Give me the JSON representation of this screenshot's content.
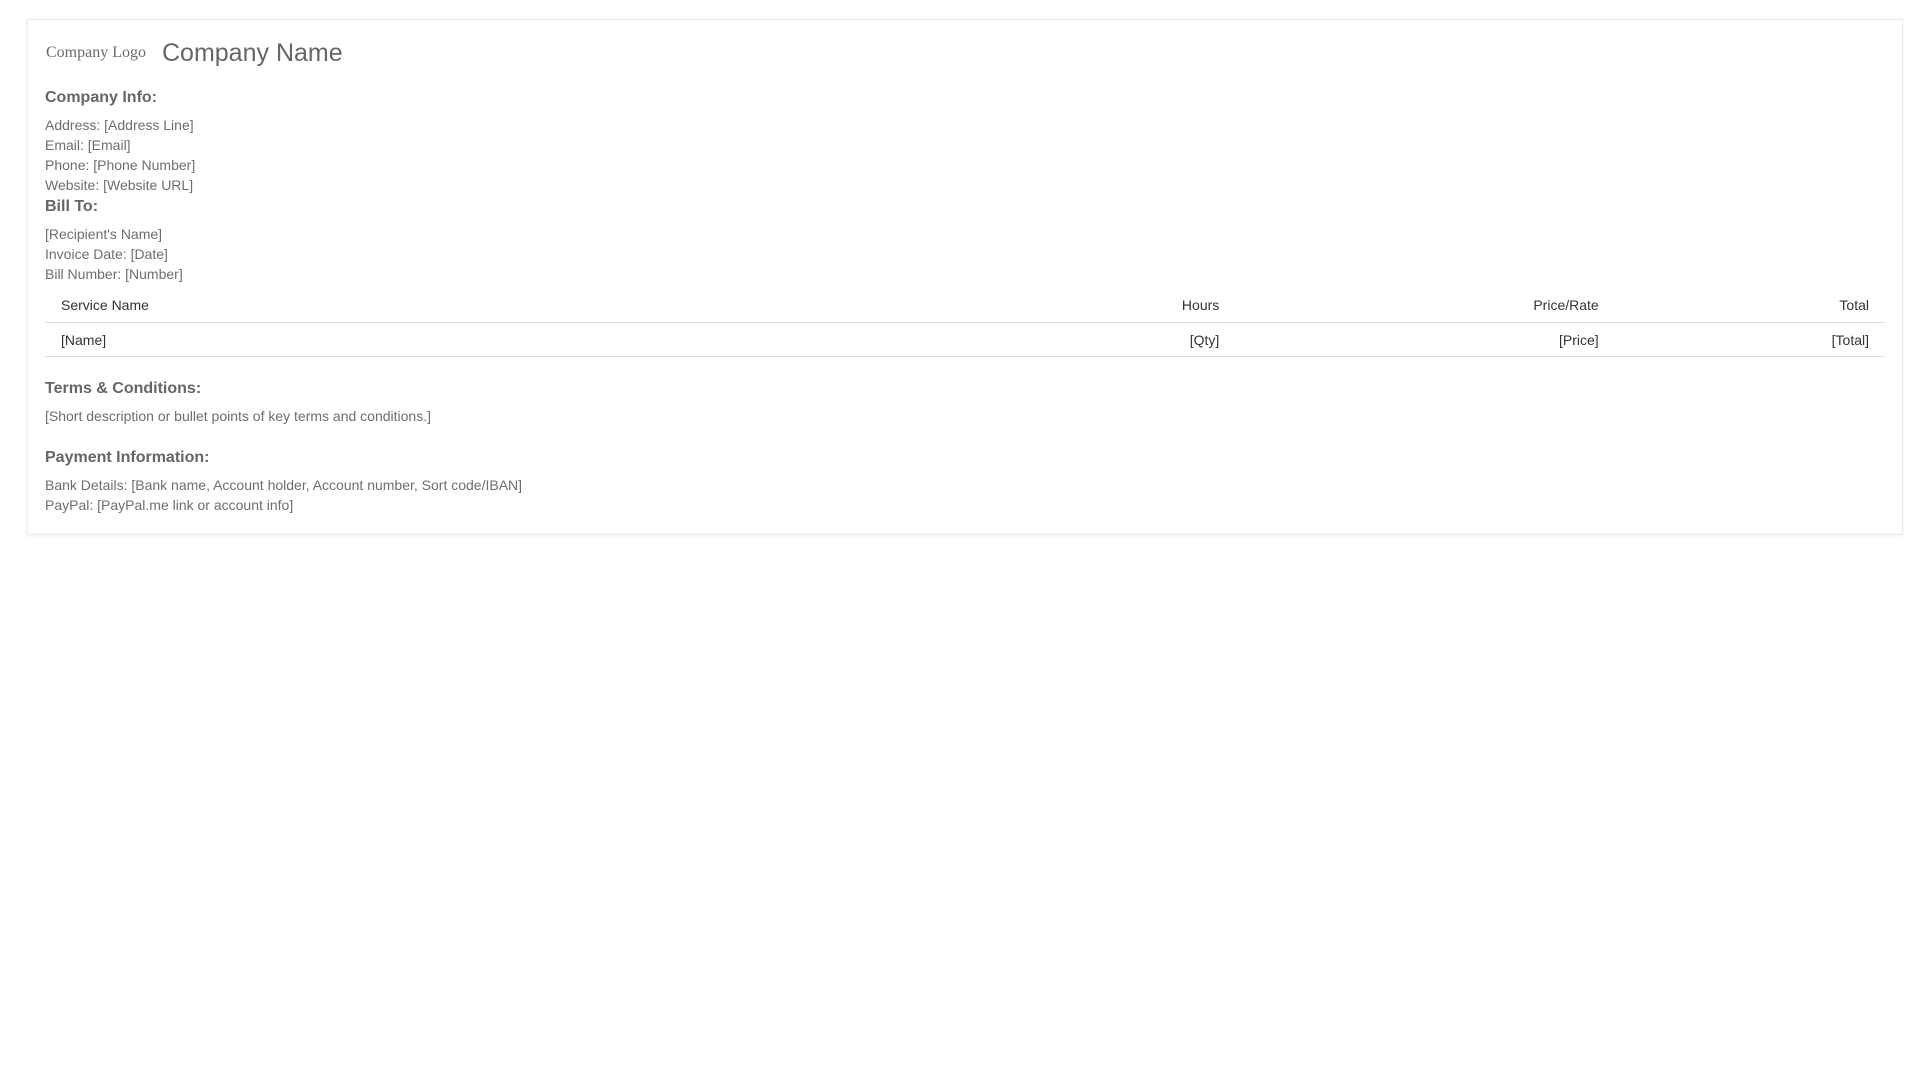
{
  "header": {
    "logo_alt": "Company Logo",
    "company_name": "Company Name"
  },
  "company_info": {
    "heading": "Company Info:",
    "address": "Address: [Address Line]",
    "email": "Email: [Email]",
    "phone": "Phone: [Phone Number]",
    "website": "Website: [Website URL]"
  },
  "bill_to": {
    "heading": "Bill To:",
    "recipient": "[Recipient's Name]",
    "invoice_date": "Invoice Date: [Date]",
    "bill_number": "Bill Number: [Number]"
  },
  "services_table": {
    "columns": [
      "Service Name",
      "Hours",
      "Price/Rate",
      "Total"
    ],
    "rows": [
      [
        "[Name]",
        "[Qty]",
        "[Price]",
        "[Total]"
      ]
    ]
  },
  "terms": {
    "heading": "Terms & Conditions:",
    "text": "[Short description or bullet points of key terms and conditions.]"
  },
  "payment": {
    "heading": "Payment Information:",
    "bank": "Bank Details: [Bank name, Account holder, Account number, Sort code/IBAN]",
    "paypal": "PayPal: [PayPal.me link or account info]"
  }
}
